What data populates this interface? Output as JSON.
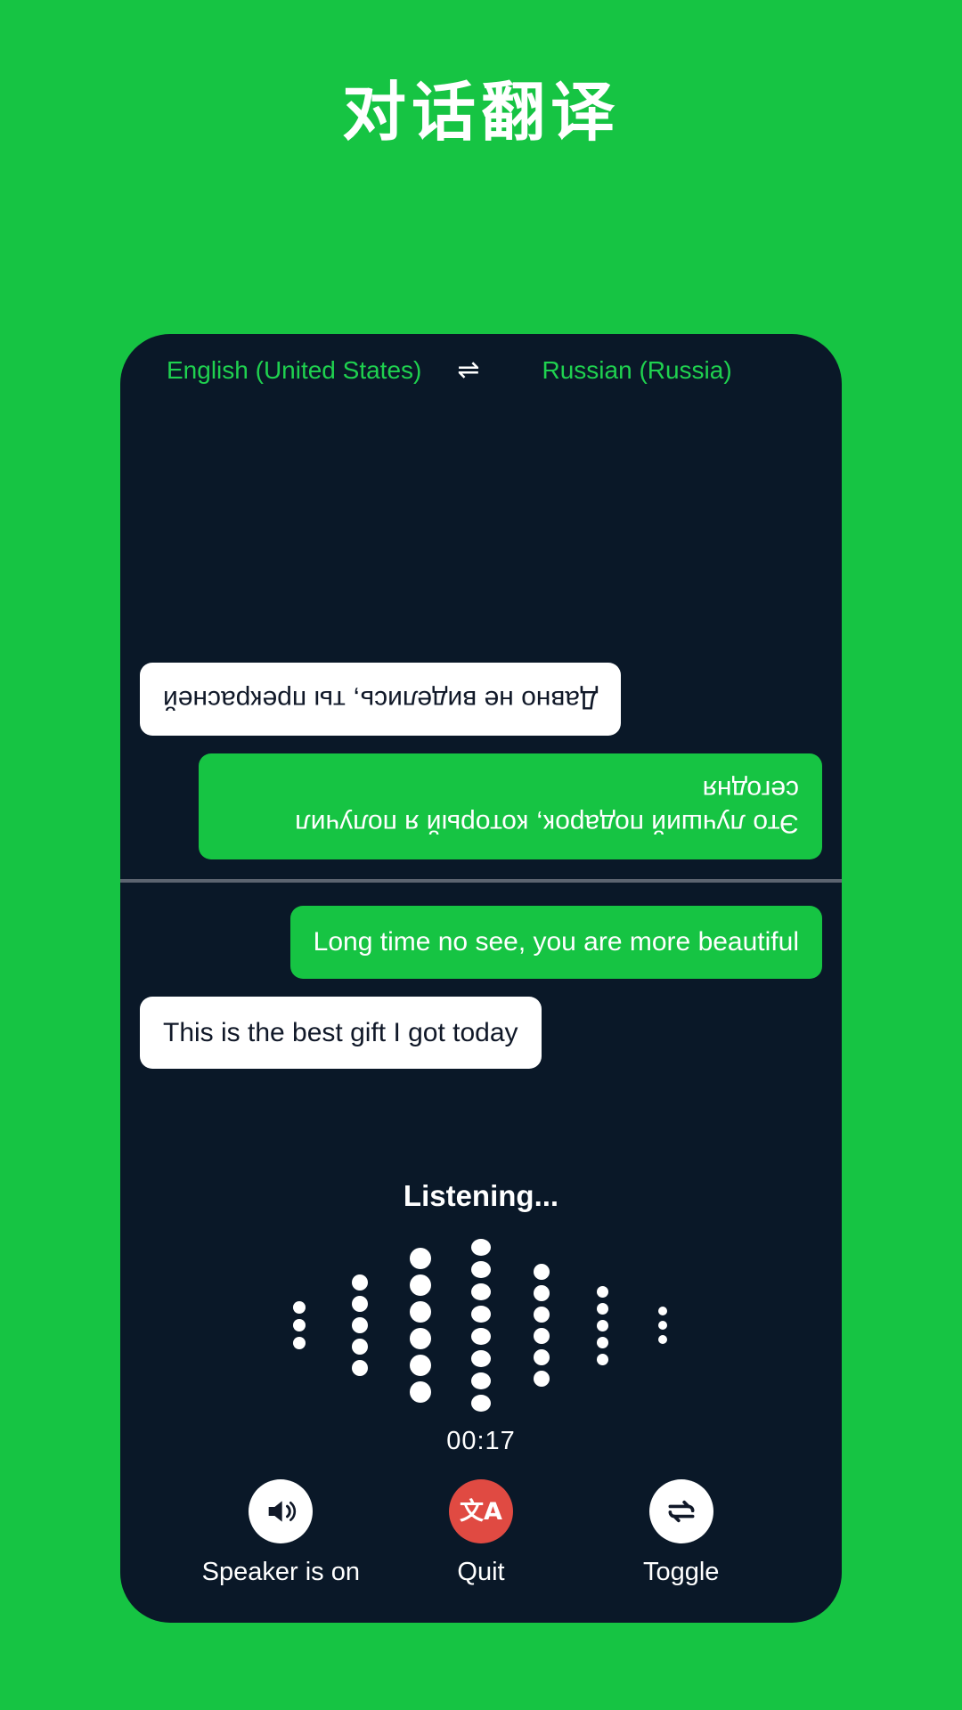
{
  "page": {
    "title": "对话翻译",
    "background_color": "#16c443",
    "panel_color": "#0a1828"
  },
  "language_bar": {
    "source_language": "English (United States)",
    "target_language": "Russian (Russia)",
    "swap_icon": "⇌"
  },
  "conversation": {
    "remote_half": {
      "orientation": "rotated-180",
      "messages": [
        {
          "text": "Это лучший подарок, который я получил сегодня",
          "style": "accent",
          "align": "left"
        },
        {
          "text": "Давно не виделись, ты прекрасней",
          "style": "plain",
          "align": "right"
        }
      ]
    },
    "local_half": {
      "orientation": "normal",
      "messages": [
        {
          "text": "Long time no see, you are more beautiful",
          "style": "accent",
          "align": "right"
        },
        {
          "text": "This is the best gift I got today",
          "style": "plain",
          "align": "left"
        }
      ]
    }
  },
  "status": {
    "listening_label": "Listening...",
    "timer": "00:17"
  },
  "waveform": {
    "columns": [
      {
        "count": 3,
        "size": 14
      },
      {
        "count": 5,
        "size": 18
      },
      {
        "count": 6,
        "size": 24
      },
      {
        "count": 8,
        "size": 22
      },
      {
        "count": 6,
        "size": 18
      },
      {
        "count": 5,
        "size": 13
      },
      {
        "count": 3,
        "size": 10
      }
    ],
    "dot_color": "#ffffff"
  },
  "controls": [
    {
      "id": "speaker",
      "label": "Speaker is on",
      "icon": "speaker-on-icon",
      "circle_color": "#ffffff",
      "icon_color": "#101828"
    },
    {
      "id": "quit",
      "label": "Quit",
      "icon": "translate-icon",
      "glyph": "文A",
      "circle_color": "#e04a42",
      "icon_color": "#ffffff"
    },
    {
      "id": "toggle",
      "label": "Toggle",
      "icon": "swap-repeat-icon",
      "circle_color": "#ffffff",
      "icon_color": "#101828"
    }
  ]
}
